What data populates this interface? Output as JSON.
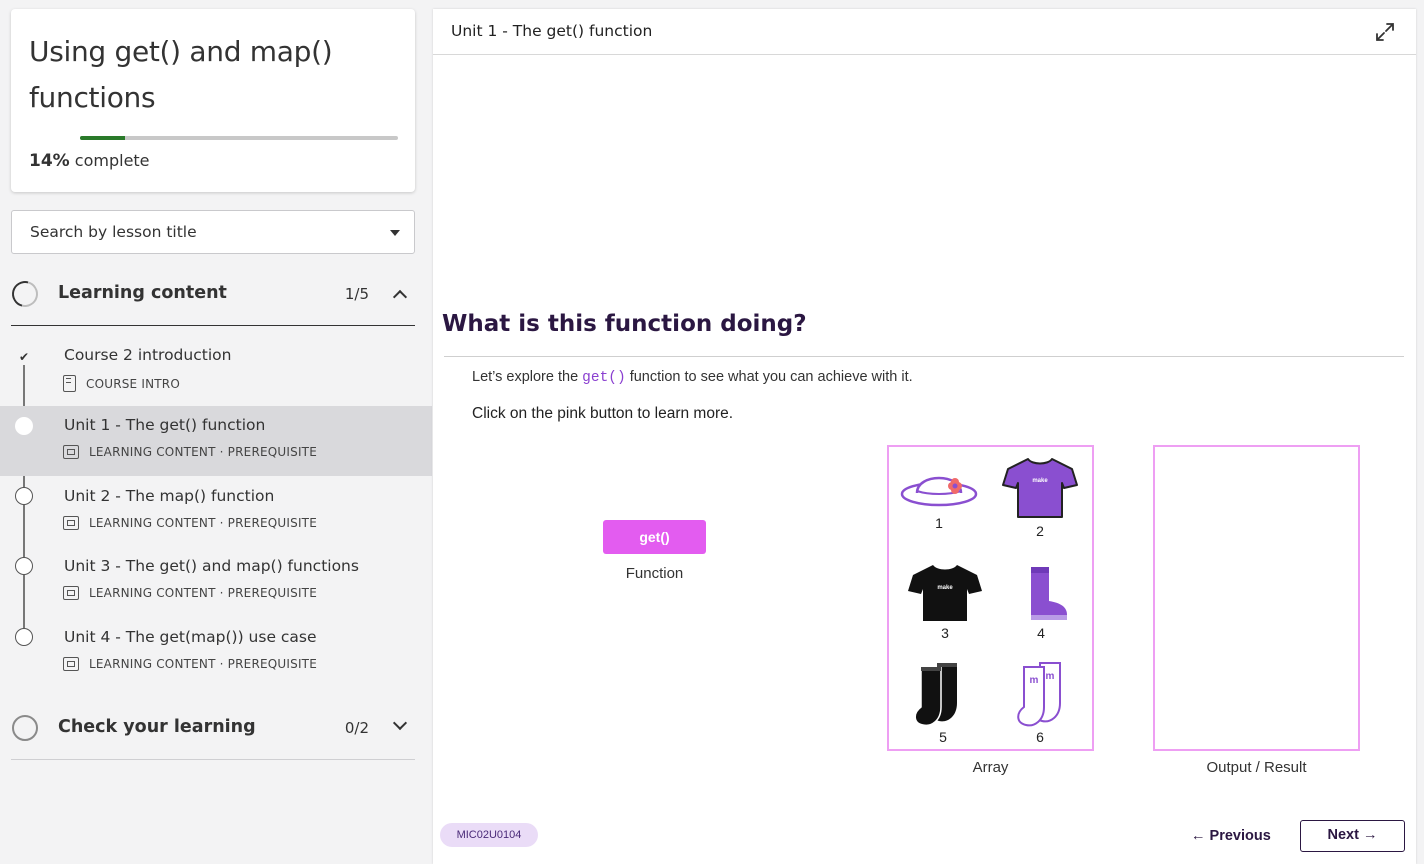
{
  "course": {
    "title": "Using get() and map() functions",
    "progress_percent": 14,
    "progress_value": "14%",
    "progress_suffix": " complete"
  },
  "search": {
    "placeholder": "Search by lesson title"
  },
  "sections": [
    {
      "label": "Learning content",
      "count": "1/5",
      "expanded": true,
      "lessons": [
        {
          "title": "Course 2 introduction",
          "meta": "COURSE INTRO",
          "status": "complete"
        },
        {
          "title": "Unit 1 - The get() function",
          "meta": "LEARNING CONTENT · PREREQUISITE",
          "status": "active"
        },
        {
          "title": "Unit 2 - The map() function",
          "meta": "LEARNING CONTENT · PREREQUISITE",
          "status": "todo"
        },
        {
          "title": "Unit 3 - The get() and map() functions",
          "meta": "LEARNING CONTENT · PREREQUISITE",
          "status": "todo"
        },
        {
          "title": "Unit 4 - The get(map()) use case",
          "meta": "LEARNING CONTENT · PREREQUISITE",
          "status": "todo"
        }
      ]
    },
    {
      "label": "Check your learning",
      "count": "0/2",
      "expanded": false
    }
  ],
  "main": {
    "header_title": "Unit 1 - The get() function",
    "question_title": "What is this function doing?",
    "intro_before": "Let’s explore the ",
    "intro_code": "get()",
    "intro_after": " function to see what you can achieve with it.",
    "instruction": "Click on the pink button to learn more.",
    "function_button": "get()",
    "function_label": "Function",
    "array_label": "Array",
    "output_label": "Output / Result",
    "array_items": [
      {
        "num": "1",
        "icon": "hat-icon"
      },
      {
        "num": "2",
        "icon": "purple-tshirt-icon"
      },
      {
        "num": "3",
        "icon": "black-tshirt-icon"
      },
      {
        "num": "4",
        "icon": "boot-icon"
      },
      {
        "num": "5",
        "icon": "black-socks-icon"
      },
      {
        "num": "6",
        "icon": "outline-socks-icon"
      }
    ],
    "tshirt_logo_text": "make",
    "socks_logo_text": "m",
    "module_code": "MIC02U0104",
    "previous_label": "Previous",
    "next_label": "Next"
  },
  "colors": {
    "accent_purple": "#8a4fd0",
    "button_pink": "#e35cf0",
    "box_border": "#ee9ff3",
    "heading": "#2b1742"
  }
}
